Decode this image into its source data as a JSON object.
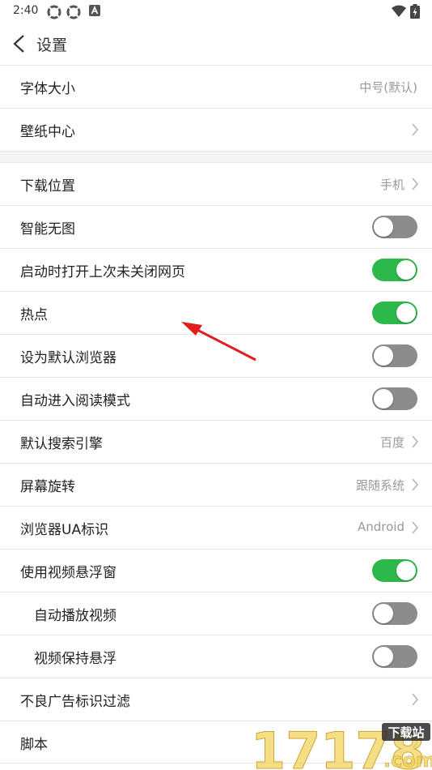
{
  "status": {
    "time": "2:40"
  },
  "header": {
    "title": "设置"
  },
  "rows": [
    {
      "label": "字体大小",
      "value": "中号(默认)"
    },
    {
      "label": "壁纸中心"
    },
    {
      "label": "下载位置",
      "value": "手机"
    },
    {
      "label": "智能无图",
      "toggle": "off"
    },
    {
      "label": "启动时打开上次未关闭网页",
      "toggle": "on"
    },
    {
      "label": "热点",
      "toggle": "on"
    },
    {
      "label": "设为默认浏览器",
      "toggle": "off"
    },
    {
      "label": "自动进入阅读模式",
      "toggle": "off"
    },
    {
      "label": "默认搜索引擎",
      "value": "百度"
    },
    {
      "label": "屏幕旋转",
      "value": "跟随系统"
    },
    {
      "label": "浏览器UA标识",
      "value": "Android"
    },
    {
      "label": "使用视频悬浮窗",
      "toggle": "on"
    },
    {
      "label": "自动播放视频",
      "toggle": "off"
    },
    {
      "label": "视频保持悬浮",
      "toggle": "off"
    },
    {
      "label": "不良广告标识过滤"
    },
    {
      "label": "脚本"
    }
  ],
  "watermark": {
    "number": "17178",
    "badge": "下载站",
    "suffix": ".com"
  },
  "colors": {
    "toggle_on": "#2db84c",
    "toggle_off": "#8c8c8c",
    "arrow": "#e02020"
  }
}
